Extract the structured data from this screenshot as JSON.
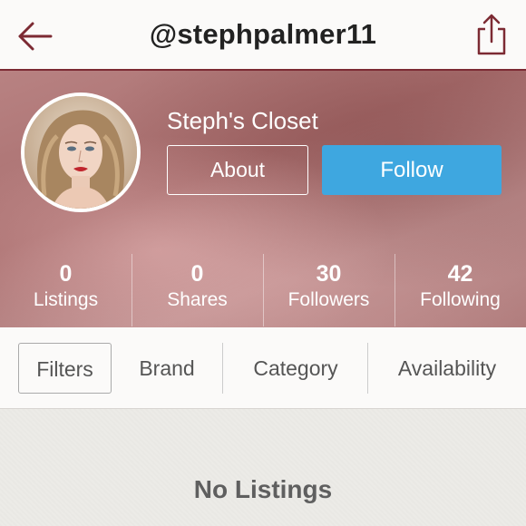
{
  "header": {
    "title": "@stephpalmer11",
    "back_icon": "back-arrow-icon",
    "share_icon": "share-icon",
    "accent_color": "#7c2a33"
  },
  "profile": {
    "closet_name": "Steph's Closet",
    "about_label": "About",
    "follow_label": "Follow",
    "follow_color": "#3ea7e0",
    "stats": [
      {
        "value": "0",
        "label": "Listings"
      },
      {
        "value": "0",
        "label": "Shares"
      },
      {
        "value": "30",
        "label": "Followers"
      },
      {
        "value": "42",
        "label": "Following"
      }
    ]
  },
  "filters": {
    "items": [
      "Filters",
      "Brand",
      "Category",
      "Availability"
    ]
  },
  "empty_state": {
    "text": "No Listings"
  }
}
